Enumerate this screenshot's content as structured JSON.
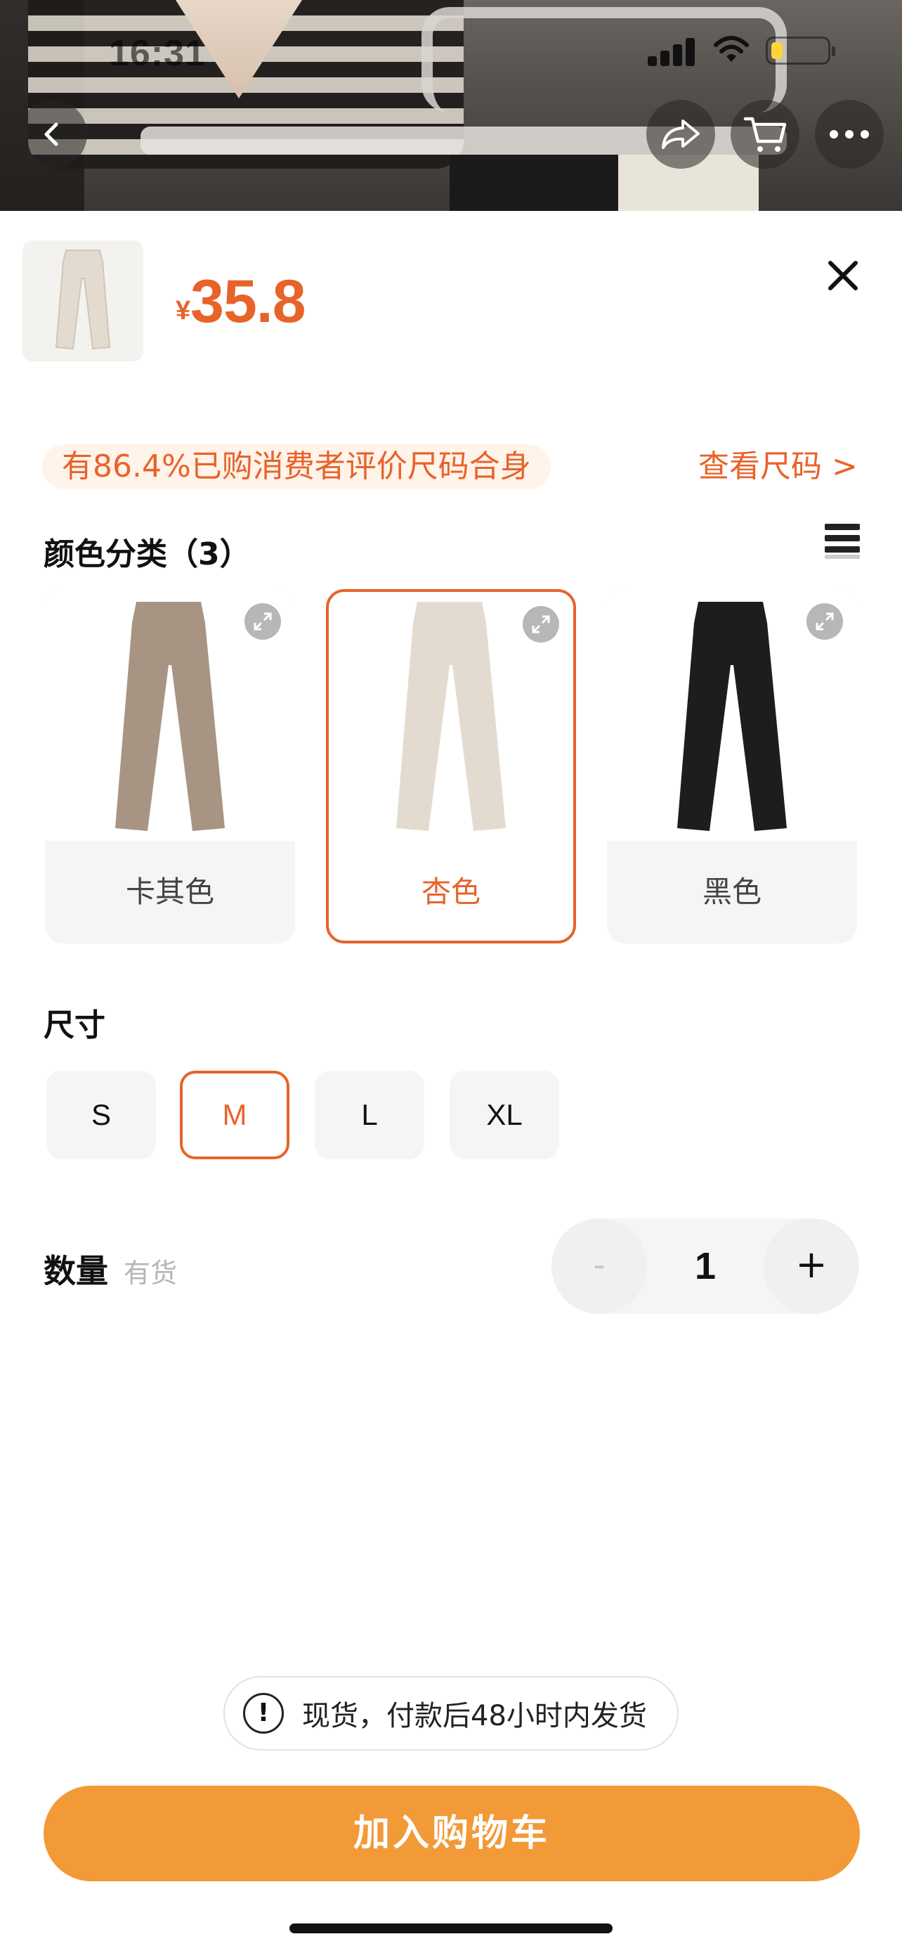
{
  "status_bar": {
    "time": "16:31"
  },
  "product": {
    "currency": "¥",
    "price": "35.8"
  },
  "fit_note": "有86.4%已购消费者评价尺码合身",
  "size_chart_link": "查看尺码 >",
  "color_section": {
    "title": "颜色分类（3）",
    "options": [
      {
        "label": "卡其色",
        "swatch": "#a89482",
        "selected": false
      },
      {
        "label": "杏色",
        "swatch": "#e3dbcf",
        "selected": true
      },
      {
        "label": "黑色",
        "swatch": "#1e1d1d",
        "selected": false
      }
    ]
  },
  "size_section": {
    "title": "尺寸",
    "options": [
      "S",
      "M",
      "L",
      "XL"
    ],
    "selected": "M"
  },
  "quantity": {
    "label": "数量",
    "stock": "有货",
    "value": "1",
    "minus": "-",
    "plus": "+"
  },
  "shipping_notice": "现货，付款后48小时内发货",
  "add_to_cart": "加入购物车",
  "colors": {
    "accent": "#e8632a",
    "cta": "#f29a38"
  }
}
